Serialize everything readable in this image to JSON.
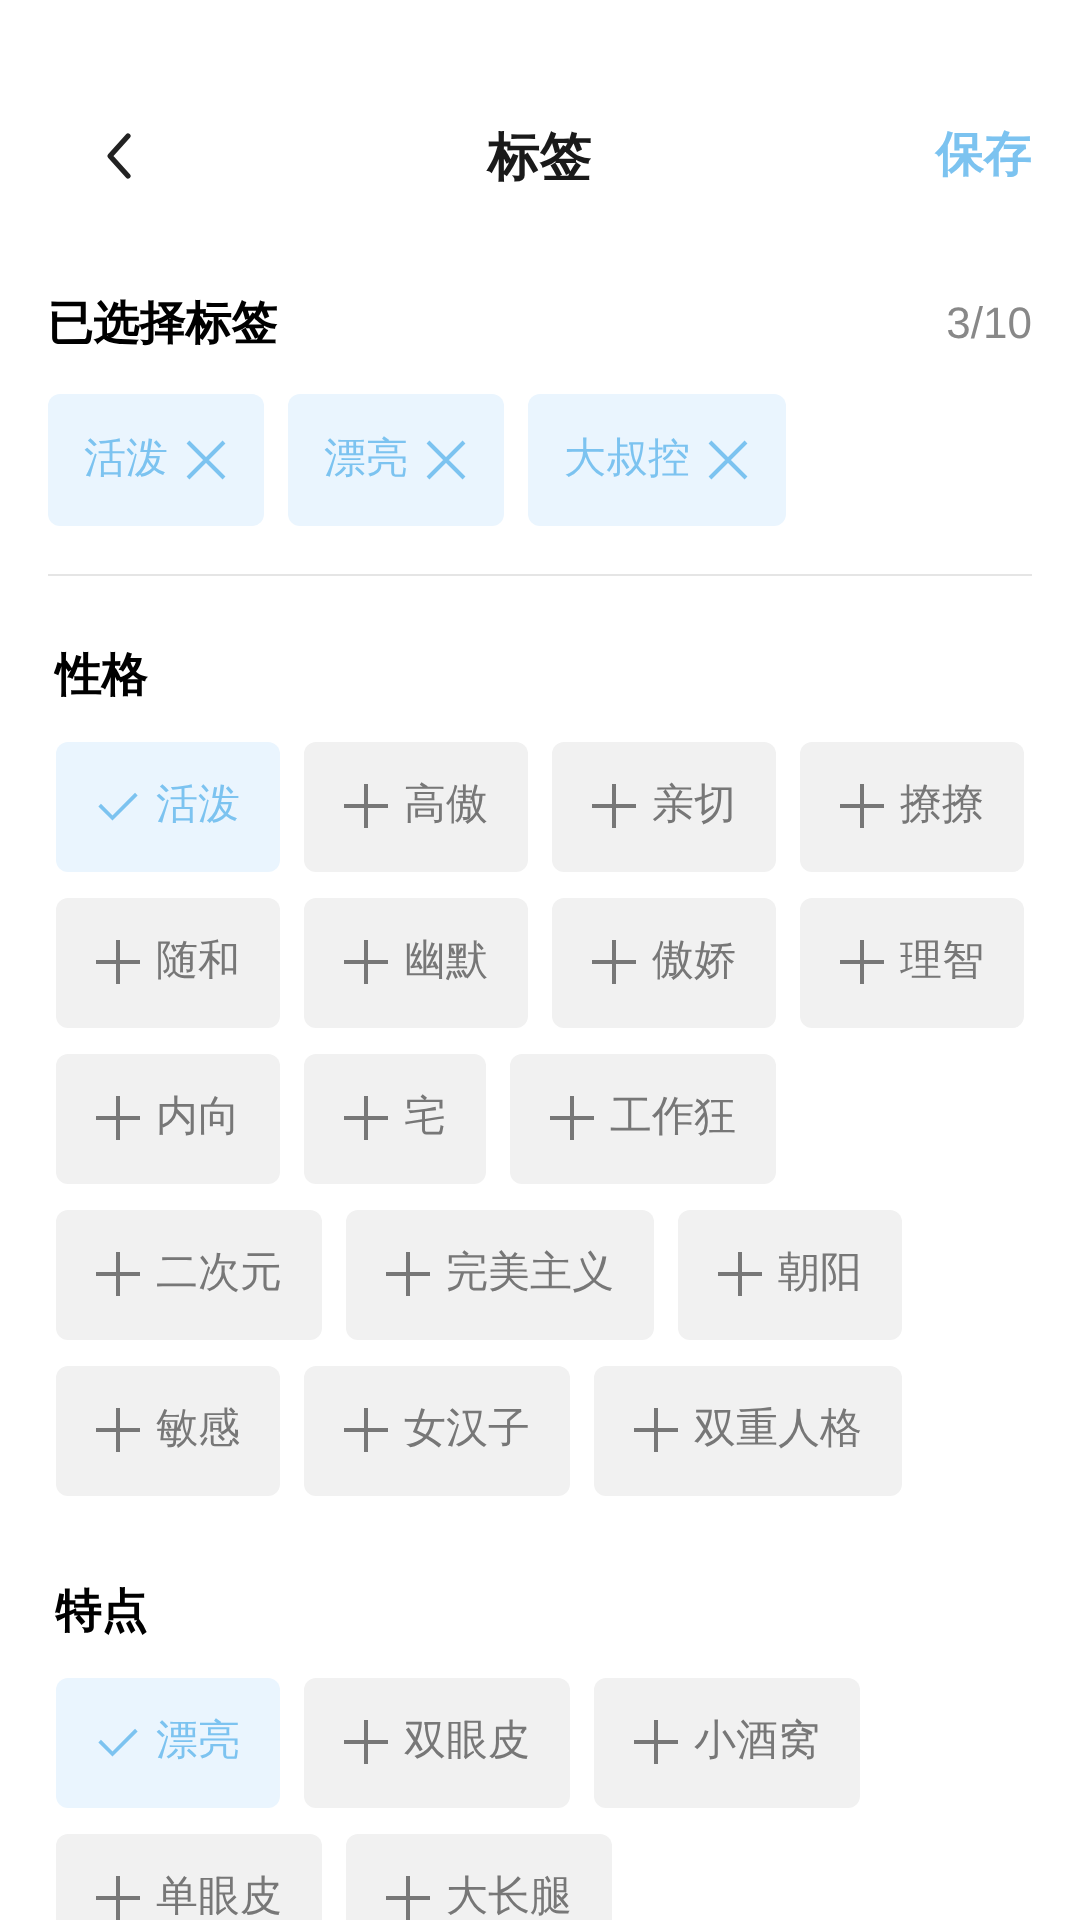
{
  "header": {
    "title": "标签",
    "save": "保存"
  },
  "selected": {
    "title": "已选择标签",
    "count": "3/10",
    "tags": [
      {
        "label": "活泼"
      },
      {
        "label": "漂亮"
      },
      {
        "label": "大叔控"
      }
    ]
  },
  "sections": [
    {
      "title": "性格",
      "tags": [
        {
          "label": "活泼",
          "selected": true
        },
        {
          "label": "高傲",
          "selected": false
        },
        {
          "label": "亲切",
          "selected": false
        },
        {
          "label": "撩撩",
          "selected": false
        },
        {
          "label": "随和",
          "selected": false
        },
        {
          "label": "幽默",
          "selected": false
        },
        {
          "label": "傲娇",
          "selected": false
        },
        {
          "label": "理智",
          "selected": false
        },
        {
          "label": "内向",
          "selected": false
        },
        {
          "label": "宅",
          "selected": false
        },
        {
          "label": "工作狂",
          "selected": false
        },
        {
          "label": "二次元",
          "selected": false
        },
        {
          "label": "完美主义",
          "selected": false
        },
        {
          "label": "朝阳",
          "selected": false
        },
        {
          "label": "敏感",
          "selected": false
        },
        {
          "label": "女汉子",
          "selected": false
        },
        {
          "label": "双重人格",
          "selected": false
        }
      ]
    },
    {
      "title": "特点",
      "tags": [
        {
          "label": "漂亮",
          "selected": true
        },
        {
          "label": "双眼皮",
          "selected": false
        },
        {
          "label": "小酒窝",
          "selected": false
        },
        {
          "label": "单眼皮",
          "selected": false
        },
        {
          "label": "大长腿",
          "selected": false
        }
      ]
    }
  ]
}
